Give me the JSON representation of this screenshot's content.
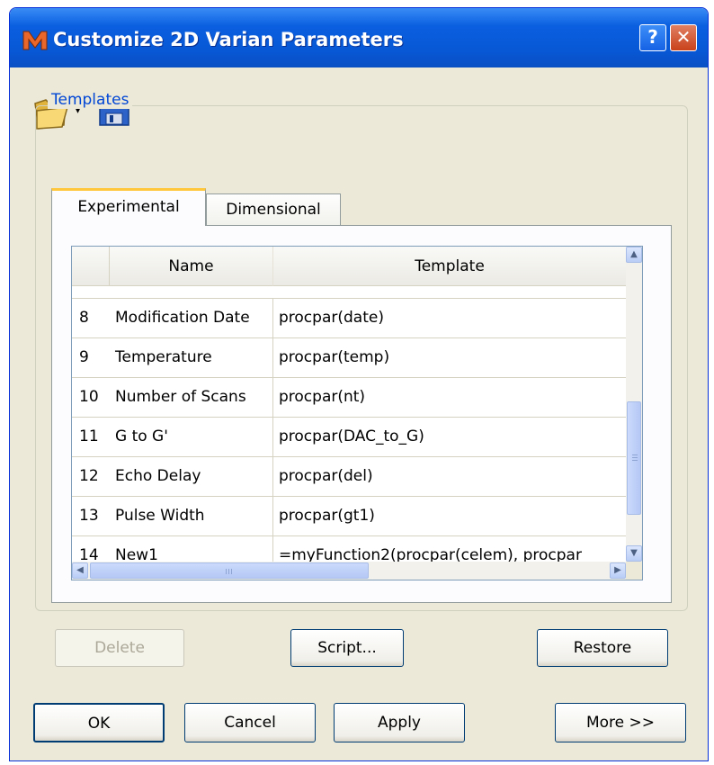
{
  "window": {
    "title": "Customize 2D Varian Parameters",
    "help_glyph": "?",
    "close_glyph": "✕"
  },
  "toolbar": {
    "open_dropdown_glyph": "▾"
  },
  "templates": {
    "group_label": "Templates",
    "tabs": [
      {
        "label": "Experimental",
        "selected": true
      },
      {
        "label": "Dimensional",
        "selected": false
      }
    ],
    "columns": [
      "",
      "Name",
      "Template"
    ],
    "rows": [
      {
        "num": "8",
        "name": "Modification Date",
        "template": "procpar(date)"
      },
      {
        "num": "9",
        "name": "Temperature",
        "template": "procpar(temp)"
      },
      {
        "num": "10",
        "name": "Number of Scans",
        "template": "procpar(nt)"
      },
      {
        "num": "11",
        "name": "G to G'",
        "template": "procpar(DAC_to_G)"
      },
      {
        "num": "12",
        "name": "Echo Delay",
        "template": "procpar(del)"
      },
      {
        "num": "13",
        "name": "Pulse Width",
        "template": "procpar(gt1)"
      },
      {
        "num": "14",
        "name": "New1",
        "template": "=myFunction2(procpar(celem), procpar"
      }
    ],
    "buttons": {
      "delete": "Delete",
      "script": "Script...",
      "restore": "Restore"
    }
  },
  "footer": {
    "ok": "OK",
    "cancel": "Cancel",
    "apply": "Apply",
    "more": "More >>"
  },
  "colors": {
    "titlebar": "#0858d6",
    "dialog_bg": "#ece9d8",
    "group_label": "#0046d5",
    "tab_highlight": "#ffc83c",
    "close_button": "#c9421b"
  }
}
